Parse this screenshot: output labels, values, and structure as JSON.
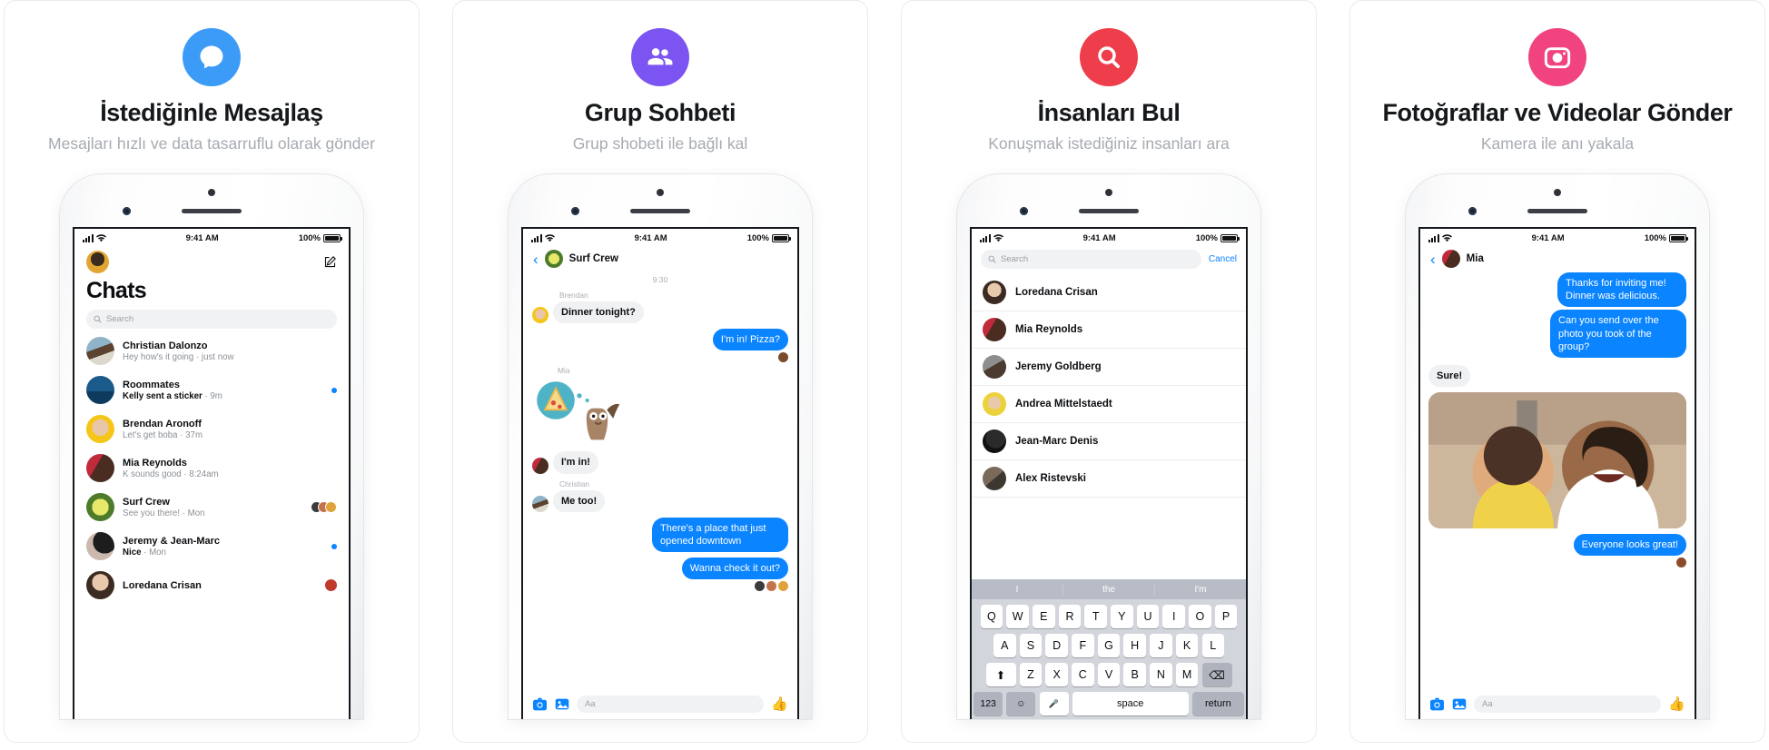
{
  "panels": [
    {
      "icon": "chat-bubble-icon",
      "icon_bg": "#3b9bf7",
      "title": "İstediğinle Mesajlaş",
      "subtitle": "Mesajları hızlı ve data tasarruflu olarak gönder",
      "screen": {
        "status": {
          "time": "9:41 AM",
          "battery": "100%"
        },
        "header": "Chats",
        "search_placeholder": "Search",
        "chats": [
          {
            "name": "Christian Dalonzo",
            "preview": "Hey how's it going · just now",
            "unread": false,
            "badge": "none"
          },
          {
            "name": "Roommates",
            "preview": "Kelly sent a sticker",
            "meta": " · 9m",
            "unread": true,
            "badge": "dot"
          },
          {
            "name": "Brendan Aronoff",
            "preview": "Let's get boba · 37m",
            "unread": false,
            "badge": "none"
          },
          {
            "name": "Mia Reynolds",
            "preview": "K sounds good · 8:24am",
            "unread": false,
            "badge": "none"
          },
          {
            "name": "Surf Crew",
            "preview": "See you there! · Mon",
            "unread": false,
            "badge": "facepile"
          },
          {
            "name": "Jeremy & Jean-Marc",
            "preview": "Nice",
            "meta": " · Mon",
            "unread": true,
            "badge": "dot"
          },
          {
            "name": "Loredana Crisan",
            "preview": "",
            "unread": false,
            "badge": "avatar"
          }
        ]
      }
    },
    {
      "icon": "group-people-icon",
      "icon_bg": "#7b54f2",
      "title": "Grup Sohbeti",
      "subtitle": "Grup shobeti ile bağlı kal",
      "screen": {
        "status": {
          "time": "9:41 AM",
          "battery": "100%"
        },
        "thread_title": "Surf Crew",
        "timestamp": "9:30",
        "messages": [
          {
            "sender": "Brendan",
            "text": "Dinner tonight?",
            "side": "in",
            "type": "text"
          },
          {
            "sender": "Mia",
            "text": "",
            "side": "in",
            "type": "sticker"
          },
          {
            "sender": "",
            "text": "I'm in! Pizza?",
            "side": "out",
            "type": "text"
          },
          {
            "sender": "",
            "text": "I'm in!",
            "side": "in",
            "type": "text"
          },
          {
            "sender": "Christian",
            "text": "Me too!",
            "side": "in",
            "type": "text"
          },
          {
            "sender": "",
            "text": "There's a place that just opened downtown",
            "side": "out",
            "type": "text"
          },
          {
            "sender": "",
            "text": "Wanna check it out?",
            "side": "out",
            "type": "text"
          }
        ],
        "composer_placeholder": "Aa",
        "composer_icons": [
          "camera-icon",
          "photo-icon",
          "thumbs-up-icon"
        ]
      }
    },
    {
      "icon": "search-icon",
      "icon_bg": "#ee3d4b",
      "title": "İnsanları Bul",
      "subtitle": "Konuşmak istediğiniz insanları ara",
      "screen": {
        "status": {
          "time": "9:41 AM",
          "battery": "100%"
        },
        "search_placeholder": "Search",
        "cancel_label": "Cancel",
        "people": [
          "Loredana Crisan",
          "Mia Reynolds",
          "Jeremy Goldberg",
          "Andrea Mittelstaedt",
          "Jean-Marc Denis",
          "Alex Ristevski"
        ],
        "keyboard": {
          "predictions": [
            "I",
            "the",
            "I'm"
          ],
          "row1": [
            "Q",
            "W",
            "E",
            "R",
            "T",
            "Y",
            "U",
            "I",
            "O",
            "P"
          ],
          "row2": [
            "A",
            "S",
            "D",
            "F",
            "G",
            "H",
            "J",
            "K",
            "L"
          ],
          "row3": [
            "Z",
            "X",
            "C",
            "V",
            "B",
            "N",
            "M"
          ],
          "shift": "⬆",
          "backspace": "⌫",
          "numbers": "123",
          "emoji": "☺",
          "mic": "🎤",
          "space": "space",
          "return": "return"
        }
      }
    },
    {
      "icon": "camera-icon",
      "icon_bg": "#f0437f",
      "title": "Fotoğraflar ve Videolar Gönder",
      "subtitle": "Kamera ile anı yakala",
      "screen": {
        "status": {
          "time": "9:41 AM",
          "battery": "100%"
        },
        "thread_title": "Mia",
        "messages": [
          {
            "text": "Thanks for inviting me! Dinner was delicious.",
            "side": "out",
            "type": "text"
          },
          {
            "text": "Can you send over the photo you took of the group?",
            "side": "out",
            "type": "text"
          },
          {
            "text": "Sure!",
            "side": "in",
            "type": "text"
          },
          {
            "text": "",
            "side": "in",
            "type": "photo"
          },
          {
            "text": "Everyone looks great!",
            "side": "out",
            "type": "text"
          }
        ],
        "composer_placeholder": "Aa",
        "composer_icons": [
          "camera-icon",
          "photo-icon",
          "thumbs-up-icon"
        ]
      }
    }
  ]
}
